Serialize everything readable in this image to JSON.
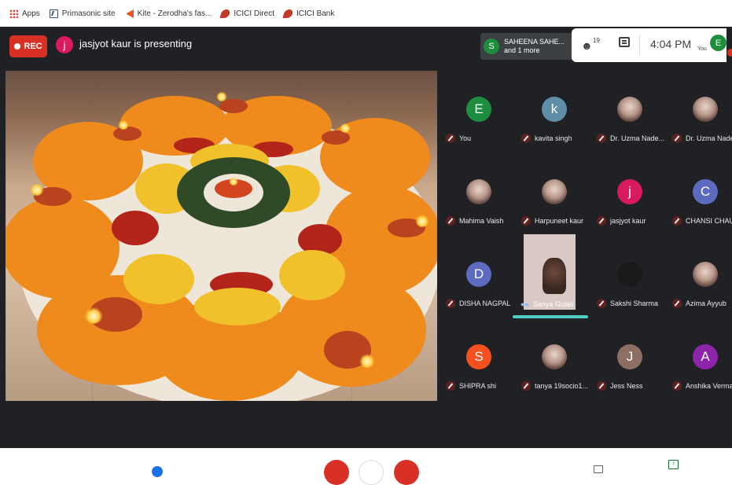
{
  "bookmarks": [
    {
      "label": "Apps",
      "icon": "apps-grid-icon"
    },
    {
      "label": "Primasonic site",
      "icon": "primasonic-icon"
    },
    {
      "label": "Kite - Zerodha's fas...",
      "icon": "kite-icon"
    },
    {
      "label": "ICICI Direct",
      "icon": "icici-icon"
    },
    {
      "label": "ICICI Bank",
      "icon": "icici-icon"
    }
  ],
  "topbar": {
    "rec_label": "REC",
    "presenter_initial": "j",
    "presenting_text": "jasjyot kaur is presenting"
  },
  "speaker": {
    "initial": "S",
    "name": "SAHEENA SAHE...",
    "more": "and 1 more"
  },
  "controls_top": {
    "people_count": "19",
    "time": "4:04 PM",
    "you_label": "You",
    "me_initial": "E"
  },
  "participants": [
    {
      "name": "You",
      "initial": "E",
      "color": "#1e8e3e",
      "kind": "letter"
    },
    {
      "name": "kavita singh",
      "initial": "k",
      "color": "#5f8fa8",
      "kind": "letter"
    },
    {
      "name": "Dr. Uzma Nade...",
      "initial": "",
      "color": "",
      "kind": "photo"
    },
    {
      "name": "Dr. Uzma Nade...",
      "initial": "",
      "color": "",
      "kind": "photo"
    },
    {
      "name": "Mahima Vaish",
      "initial": "",
      "color": "",
      "kind": "photo"
    },
    {
      "name": "Harpuneet kaur",
      "initial": "",
      "color": "",
      "kind": "photo"
    },
    {
      "name": "jasjyot kaur",
      "initial": "j",
      "color": "#d81b60",
      "kind": "letter"
    },
    {
      "name": "CHANSI CHAU...",
      "initial": "C",
      "color": "#5c6bc0",
      "kind": "letter"
    },
    {
      "name": "DISHA NAGPAL",
      "initial": "D",
      "color": "#5c6bc0",
      "kind": "letter"
    },
    {
      "name": "Sanya Gulati",
      "initial": "",
      "color": "",
      "kind": "active"
    },
    {
      "name": "Sakshi Sharma",
      "initial": "",
      "color": "",
      "kind": "dark"
    },
    {
      "name": "Azima Ayyub",
      "initial": "",
      "color": "",
      "kind": "photo"
    },
    {
      "name": "SHIPRA shi",
      "initial": "S",
      "color": "#f4511e",
      "kind": "letter"
    },
    {
      "name": "tanya 19socio1...",
      "initial": "",
      "color": "",
      "kind": "photo"
    },
    {
      "name": "Jess Ness",
      "initial": "J",
      "color": "#8d6e63",
      "kind": "letter"
    },
    {
      "name": "Anshika Verma",
      "initial": "A",
      "color": "#8e24aa",
      "kind": "letter"
    }
  ],
  "presentation": {
    "colors": {
      "marigold": "#f28c1a",
      "yellow": "#f2c22a",
      "red": "#b8231c",
      "green": "#2e4a26",
      "rice": "#f4eee4"
    }
  }
}
